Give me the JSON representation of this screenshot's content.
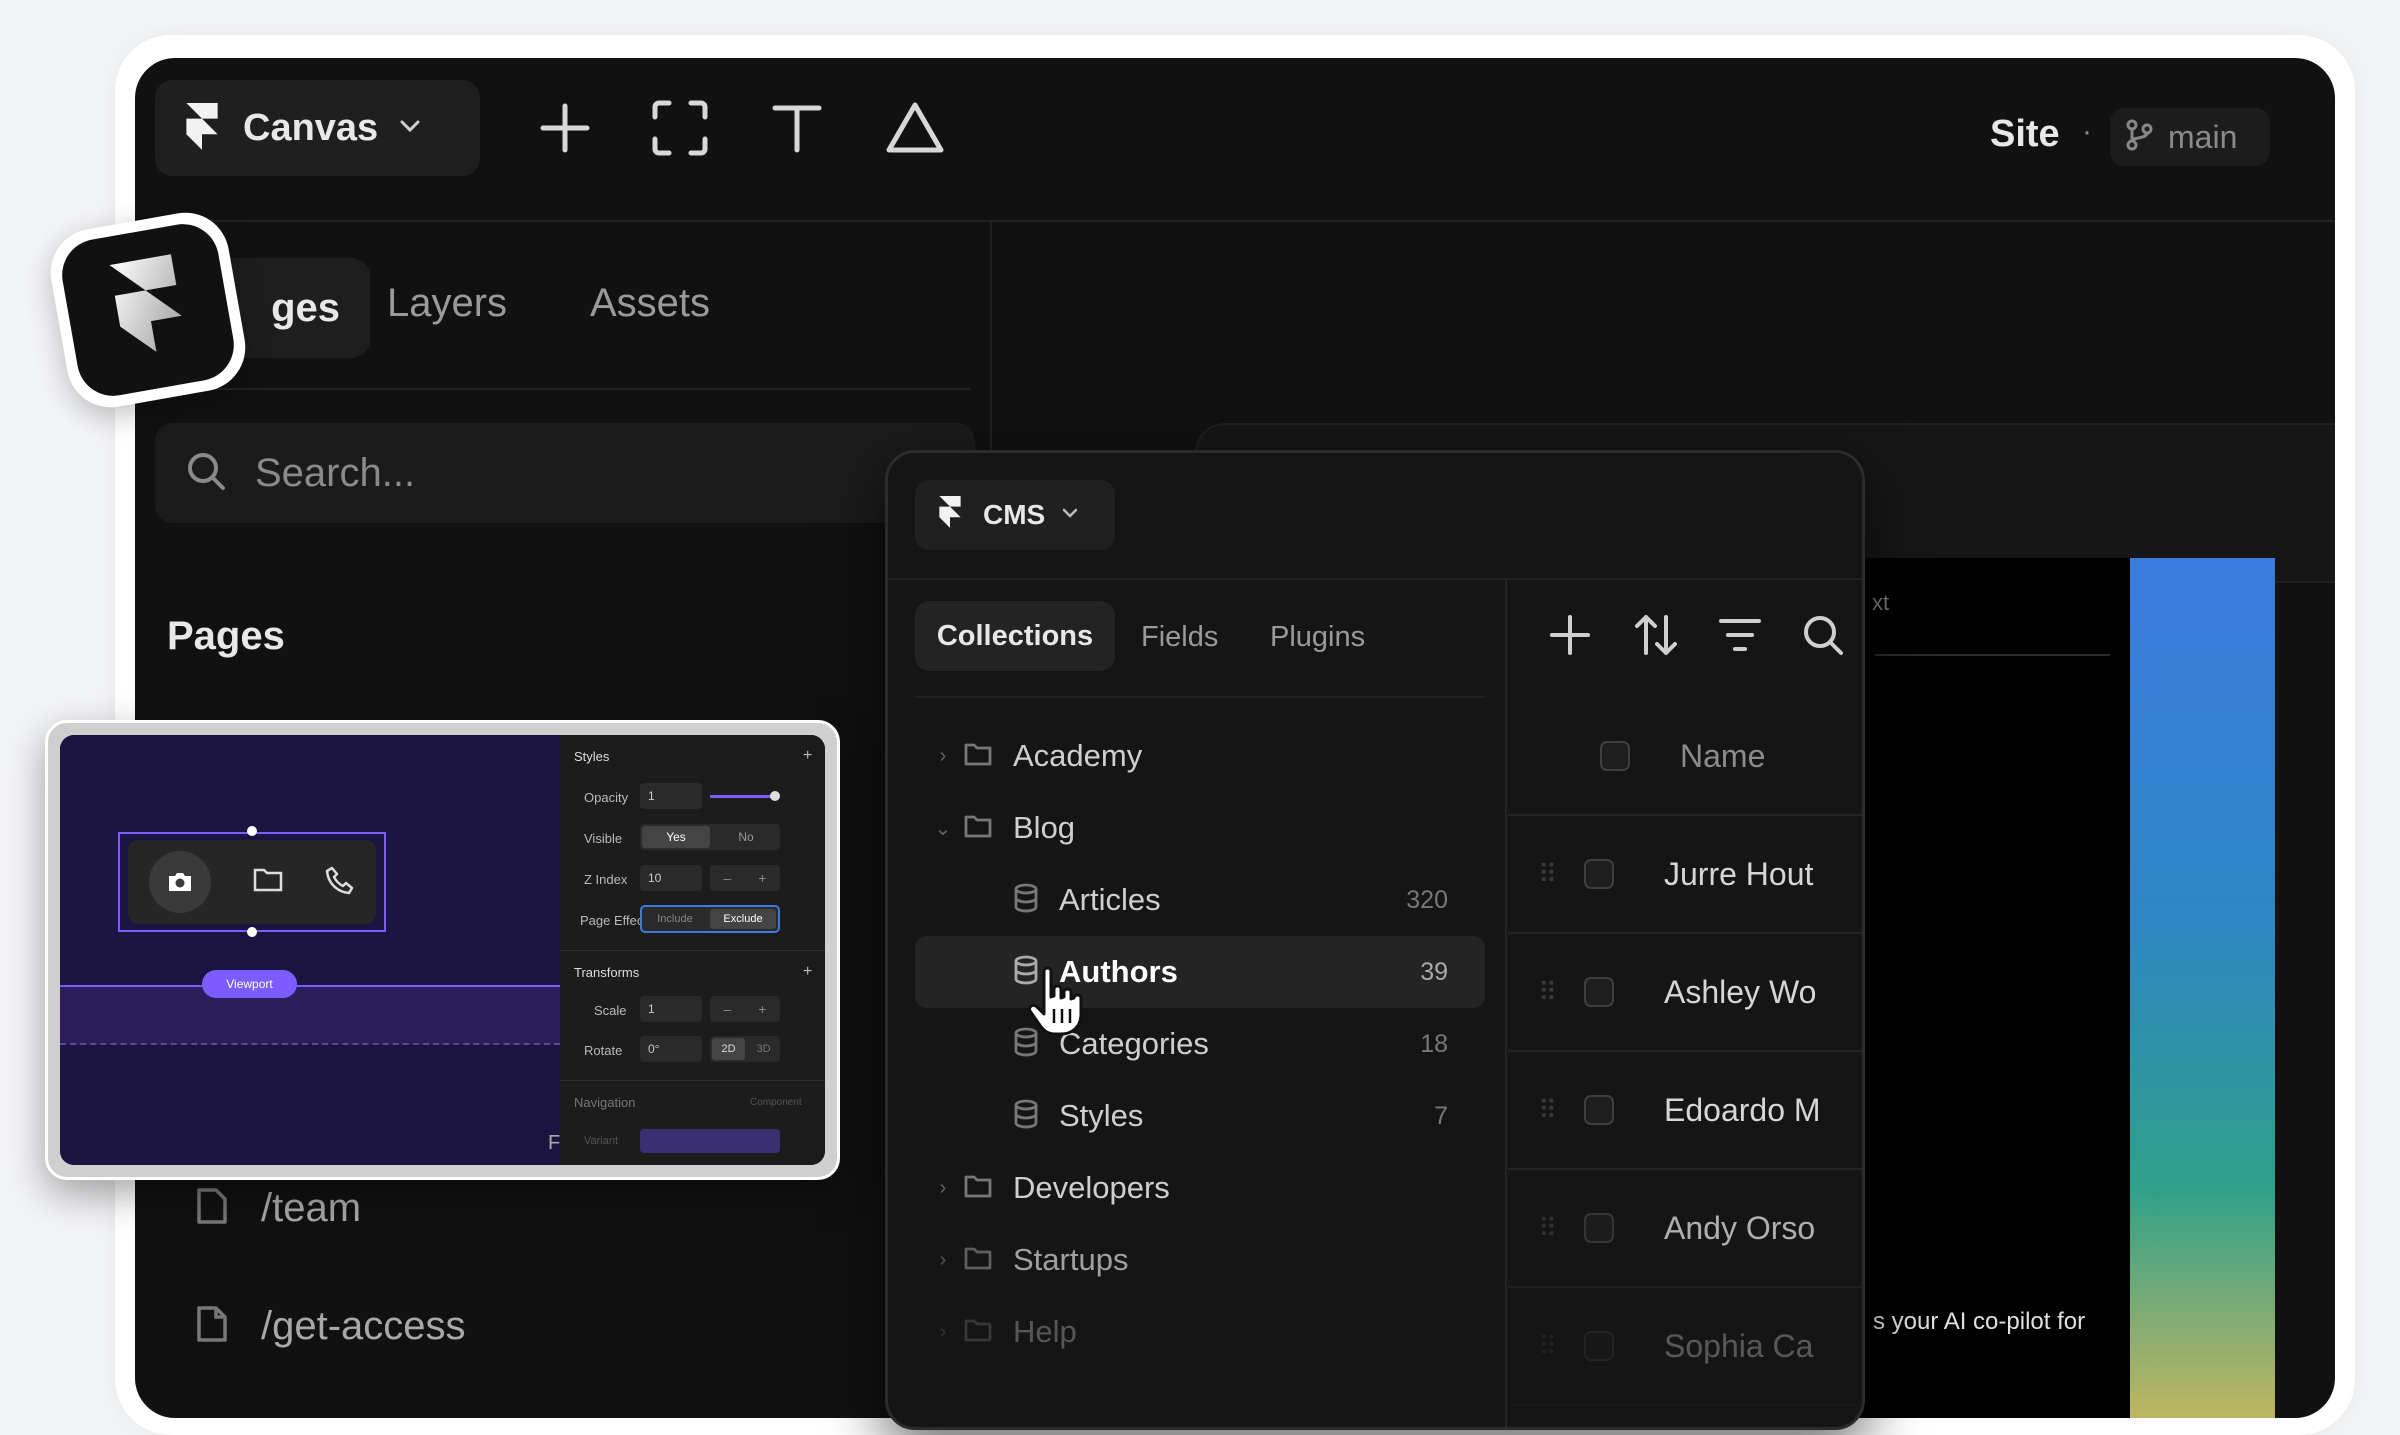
{
  "toolbar": {
    "app_name": "Canvas",
    "site_label": "Site",
    "separator": "·",
    "branch": "main"
  },
  "left_panel": {
    "tabs": [
      "Pages",
      "Layers",
      "Assets"
    ],
    "visible_tab_fragment": "ges",
    "search_placeholder": "Search...",
    "section_title": "Pages",
    "pages": [
      "/team",
      "/get-access"
    ],
    "partial_page_text": "/team"
  },
  "cms": {
    "title": "CMS",
    "tabs": [
      "Collections",
      "Fields",
      "Plugins"
    ],
    "active_tab": "Collections",
    "tree": [
      {
        "label": "Academy",
        "type": "folder",
        "expanded": false
      },
      {
        "label": "Blog",
        "type": "folder",
        "expanded": true
      },
      {
        "label": "Articles",
        "type": "collection",
        "count": "320"
      },
      {
        "label": "Authors",
        "type": "collection",
        "count": "39",
        "selected": true
      },
      {
        "label": "Categories",
        "type": "collection",
        "count": "18"
      },
      {
        "label": "Styles",
        "type": "collection",
        "count": "7"
      },
      {
        "label": "Developers",
        "type": "folder",
        "expanded": false
      },
      {
        "label": "Startups",
        "type": "folder",
        "expanded": false
      },
      {
        "label": "Help",
        "type": "folder",
        "expanded": false
      }
    ],
    "table_header": "Name",
    "rows": [
      "Jurre Hout",
      "Ashley Wo",
      "Edoardo M",
      "Andy Orso",
      "Sophia Ca"
    ]
  },
  "preview": {
    "top_text_fragment": "xt",
    "bottom_text_fragment": "s your AI co-pilot for"
  },
  "mini_panel": {
    "styles_label": "Styles",
    "opacity_label": "Opacity",
    "opacity_value": "1",
    "opacity_level": 1.0,
    "visible_label": "Visible",
    "visible_yes": "Yes",
    "visible_no": "No",
    "zindex_label": "Z Index",
    "zindex_value": "10",
    "page_effect_label": "Page Effect",
    "include": "Include",
    "exclude": "Exclude",
    "transforms_label": "Transforms",
    "scale_label": "Scale",
    "scale_value": "1",
    "rotate_label": "Rotate",
    "rotate_value": "0°",
    "mode_2d": "2D",
    "mode_3d": "3D",
    "navigation_label": "Navigation",
    "component_label": "Component",
    "variant_label": "Variant",
    "viewport_label": "Viewport",
    "corner_letter": "F"
  },
  "colors": {
    "app_bg": "#111111",
    "accent_purple": "#7c5cff",
    "preview_gradient": [
      "#3a7be0",
      "#2fa08a",
      "#d8b95a"
    ]
  }
}
